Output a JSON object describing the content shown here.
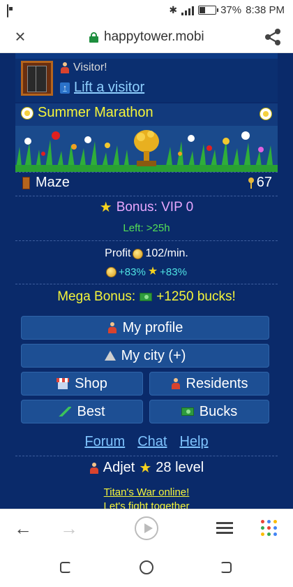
{
  "status_bar": {
    "battery": "37%",
    "time": "8:38 PM"
  },
  "browser": {
    "url": "happytower.mobi"
  },
  "icons": {
    "status": [
      "sim-icon",
      "bluetooth-icon",
      "signal-icon",
      "battery-icon"
    ],
    "address": [
      "close-icon",
      "lock-icon",
      "share-icon"
    ],
    "page": [
      "elevator-door-icon",
      "visitor-icon",
      "lift-arrow-icon",
      "flower-icon",
      "trophy-icon",
      "maze-door-icon",
      "key-icon",
      "star-icon",
      "coin-icon",
      "bill-icon",
      "person-icon",
      "city-icon",
      "shop-icon",
      "best-icon"
    ],
    "toolbar": [
      "back-arrow-icon",
      "forward-arrow-icon",
      "play-icon",
      "list-icon",
      "apps-grid-icon"
    ],
    "navbar": [
      "recent-apps-icon",
      "home-icon",
      "back-icon"
    ]
  },
  "page": {
    "visitor": {
      "label": "Visitor!",
      "lift_link": "Lift a visitor"
    },
    "event": {
      "title": "Summer Marathon"
    },
    "maze": {
      "label": "Maze",
      "keys": "67"
    },
    "bonus": {
      "text": "Bonus: VIP 0",
      "left": "Left: >25h"
    },
    "profit": {
      "prefix": "Profit",
      "value": "102/min.",
      "coin_pct": "+83%",
      "star_pct": "+83%"
    },
    "mega_bonus": {
      "prefix": "Mega Bonus:",
      "value": "+1250 bucks!"
    },
    "menu": {
      "my_profile": "My profile",
      "my_city": "My city (+)",
      "shop": "Shop",
      "residents": "Residents",
      "best": "Best",
      "bucks": "Bucks"
    },
    "footer_links": {
      "forum": "Forum",
      "chat": "Chat",
      "help": "Help"
    },
    "user": {
      "name": "Adjet",
      "level": "28 level"
    },
    "promo": {
      "line1": "Titan's War online!",
      "line2": "Let's fight together"
    }
  },
  "colors": {
    "page_bg": "#0a2a6a",
    "button_bg": "#1d4f94",
    "yellow_text": "#f5f53a",
    "link_blue": "#7fc4ff",
    "pink_text": "#e9a8ff",
    "green_text": "#55e055",
    "cyan_text": "#4fe3e3",
    "secure_green": "#1e8e3e",
    "app_dots": [
      "#e94335",
      "#4285f4",
      "#fbbc05",
      "#34a853",
      "#e94335",
      "#4285f4",
      "#fbbc05",
      "#34a853",
      "#4285f4"
    ]
  }
}
